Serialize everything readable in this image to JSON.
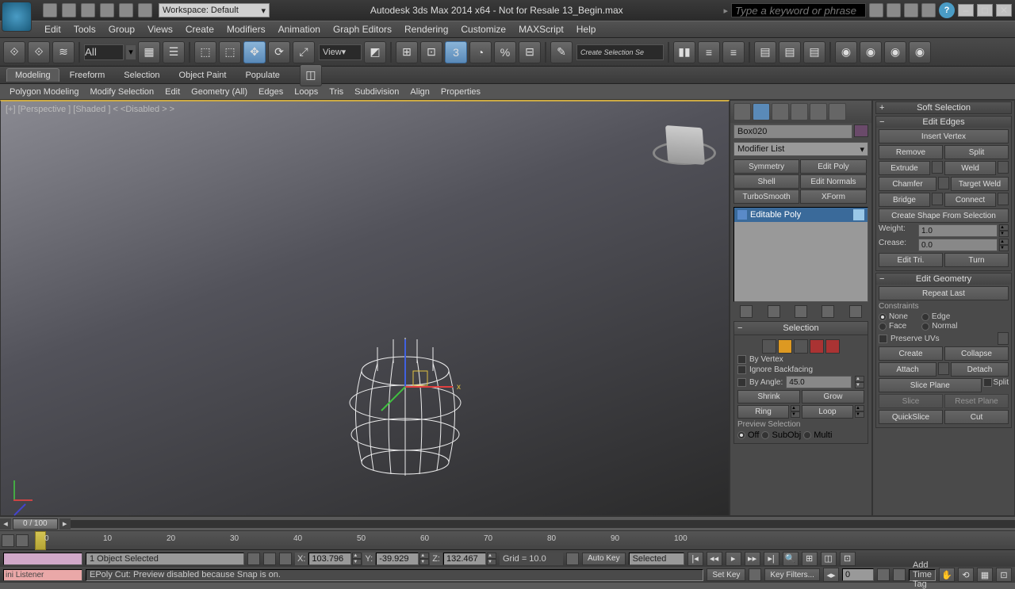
{
  "titlebar": {
    "workspace_dd": "Workspace: Default",
    "title": "Autodesk 3ds Max  2014 x64 - Not for Resale   13_Begin.max",
    "search_placeholder": "Type a keyword or phrase"
  },
  "menubar": [
    "Edit",
    "Tools",
    "Group",
    "Views",
    "Create",
    "Modifiers",
    "Animation",
    "Graph Editors",
    "Rendering",
    "Customize",
    "MAXScript",
    "Help"
  ],
  "toolbar": {
    "filter": "All",
    "coord": "View",
    "create_sel": "Create Selection Se"
  },
  "ribbon": {
    "tabs": [
      "Modeling",
      "Freeform",
      "Selection",
      "Object Paint",
      "Populate"
    ],
    "sub": [
      "Polygon Modeling",
      "Modify Selection",
      "Edit",
      "Geometry (All)",
      "Edges",
      "Loops",
      "Tris",
      "Subdivision",
      "Align",
      "Properties"
    ]
  },
  "viewport": {
    "label": "[+] [Perspective ] [Shaded ]    < <Disabled > >"
  },
  "cmd": {
    "obj_name": "Box020",
    "mod_list": "Modifier List",
    "preset_btns": [
      "Symmetry",
      "Edit Poly",
      "Shell",
      "Edit Normals",
      "TurboSmooth",
      "XForm"
    ],
    "stack_item": "Editable Poly",
    "selection": {
      "by_vertex": "By Vertex",
      "ignore_bf": "Ignore Backfacing",
      "by_angle": "By Angle:",
      "angle_val": "45.0",
      "shrink": "Shrink",
      "grow": "Grow",
      "ring": "Ring",
      "loop": "Loop",
      "preview": "Preview Selection",
      "off": "Off",
      "subobj": "SubObj",
      "multi": "Multi"
    }
  },
  "right": {
    "soft_sel": "Soft Selection",
    "edit_edges": "Edit Edges",
    "insert_vertex": "Insert Vertex",
    "remove": "Remove",
    "split": "Split",
    "extrude": "Extrude",
    "weld": "Weld",
    "chamfer": "Chamfer",
    "target_weld": "Target Weld",
    "bridge": "Bridge",
    "connect": "Connect",
    "create_shape": "Create Shape From Selection",
    "weight": "Weight:",
    "weight_v": "1.0",
    "crease": "Crease:",
    "crease_v": "0.0",
    "edit_tri": "Edit Tri.",
    "turn": "Turn",
    "edit_geo": "Edit Geometry",
    "repeat": "Repeat Last",
    "constraints": "Constraints",
    "c_none": "None",
    "c_edge": "Edge",
    "c_face": "Face",
    "c_normal": "Normal",
    "preserve_uv": "Preserve UVs",
    "create": "Create",
    "collapse": "Collapse",
    "attach": "Attach",
    "detach": "Detach",
    "slice_plane": "Slice Plane",
    "slice_split": "Split",
    "slice": "Slice",
    "reset_plane": "Reset Plane",
    "quickslice": "QuickSlice",
    "cut": "Cut"
  },
  "slider": {
    "frame": "0 / 100"
  },
  "track": {
    "ticks": [
      {
        "v": "0",
        "p": 56
      },
      {
        "v": "10",
        "p": 130
      },
      {
        "v": "20",
        "p": 210
      },
      {
        "v": "30",
        "p": 290
      },
      {
        "v": "40",
        "p": 370
      },
      {
        "v": "50",
        "p": 450
      },
      {
        "v": "60",
        "p": 530
      },
      {
        "v": "70",
        "p": 610
      },
      {
        "v": "80",
        "p": 690
      },
      {
        "v": "90",
        "p": 770
      },
      {
        "v": "100",
        "p": 850
      }
    ]
  },
  "status": {
    "selected": "1 Object Selected",
    "x": "103.796",
    "y": "-39.929",
    "z": "132.467",
    "grid": "Grid = 10.0",
    "auto_key": "Auto Key",
    "key_mode": "Selected",
    "set_key": "Set Key",
    "key_filters": "Key Filters...",
    "cur_frame": "0"
  },
  "prompt": {
    "listener": "ini Listener",
    "msg": "EPoly Cut: Preview disabled because Snap is on.",
    "add_tag": "Add Time Tag"
  }
}
